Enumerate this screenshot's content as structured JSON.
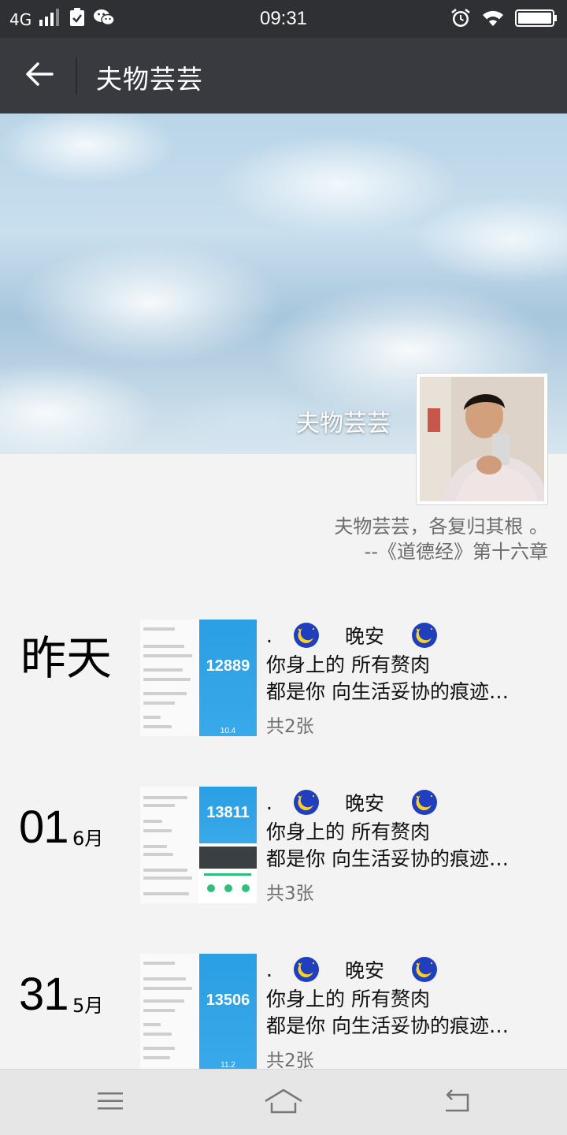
{
  "status_bar": {
    "network": "4G",
    "time": "09:31"
  },
  "header": {
    "title": "夫物芸芸"
  },
  "profile": {
    "cover_name": "夫物芸芸",
    "signature_line1": "夫物芸芸，各复归其根 。",
    "signature_line2": "--《道德经》第十六章"
  },
  "posts": [
    {
      "date_label": "昨天",
      "line1_dot": ".",
      "line1_text": "晚安",
      "line2": "你身上的 所有赘肉",
      "line3": "都是你 向生活妥协的痕迹…",
      "count": "共2张",
      "thumb_number": "12889",
      "thumb_small": "10.4"
    },
    {
      "day": "01",
      "month": "6月",
      "line1_dot": ".",
      "line1_text": "晚安",
      "line2": "你身上的 所有赘肉",
      "line3": "都是你 向生活妥协的痕迹…",
      "count": "共3张",
      "thumb_number": "13811"
    },
    {
      "day": "31",
      "month": "5月",
      "line1_dot": ".",
      "line1_text": "晚安",
      "line2": "你身上的 所有赘肉",
      "line3": "都是你 向生活妥协的痕迹…",
      "count": "共2张",
      "thumb_number": "13506",
      "thumb_small": "11.2"
    }
  ],
  "icons": {
    "status": [
      "signal-icon",
      "clipboard-check-icon",
      "wechat-icon",
      "alarm-icon",
      "wifi-icon",
      "battery-icon"
    ],
    "header": [
      "back-arrow-icon"
    ],
    "post": [
      "moon-emoji-icon"
    ],
    "nav": [
      "menu-icon",
      "home-icon",
      "back-icon"
    ]
  },
  "colors": {
    "status_bar": "#2e3033",
    "title_bar": "#393a3f",
    "page_bg": "#f3f3f3",
    "thumb_blue": "#2a9fe3",
    "moon_blue": "#1f3fbf",
    "moon_yellow": "#ffd21f"
  }
}
